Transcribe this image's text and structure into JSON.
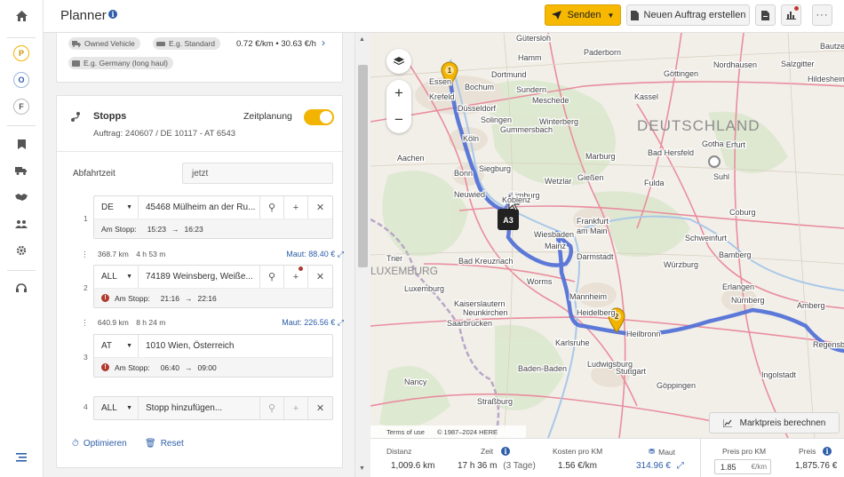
{
  "rail": {
    "icons": [
      "home-icon",
      "bookmark-icon",
      "truck-icon",
      "handshake-icon",
      "users-icon",
      "gear-icon",
      "headset-icon",
      "sidebar-toggle-icon"
    ],
    "circles": [
      {
        "letter": "P",
        "color": "#f2b400"
      },
      {
        "letter": "O",
        "color": "#2d5ea8"
      },
      {
        "letter": "F",
        "color": "#555555"
      }
    ]
  },
  "header": {
    "title": "Planner",
    "send_label": "Senden",
    "new_order_label": "Neuen Auftrag erstellen"
  },
  "vehicle": {
    "vehicle_chip": "Owned Vehicle",
    "standard_chip": "E.g. Standard",
    "price_text": "0.72 €/km • 30.63 €/h",
    "region_chip": "E.g. Germany (long haul)"
  },
  "stops": {
    "title": "Stopps",
    "order_text": "Auftrag: 240607 / DE 10117 - AT 6543",
    "schedule_label": "Zeitplanung",
    "departure_label": "Abfahrtzeit",
    "departure_value": "jetzt",
    "items": [
      {
        "num": "1",
        "country": "DE",
        "address": "45468 Mülheim an der Ru...",
        "stop_label": "Am Stopp:",
        "arrive": "15:23",
        "depart": "16:23"
      },
      {
        "num": "2",
        "country": "ALL",
        "address": "74189 Weinsberg, Weiße...",
        "stop_label": "Am Stopp:",
        "arrive": "21:16",
        "depart": "22:16"
      },
      {
        "num": "3",
        "country": "AT",
        "address": "1010 Wien, Österreich",
        "stop_label": "Am Stopp:",
        "arrive": "06:40",
        "depart": "09:00"
      },
      {
        "num": "4",
        "country": "ALL",
        "placeholder": "Stopp hinzufügen..."
      }
    ],
    "legs": [
      {
        "km": "368.7 km",
        "time": "4 h 53 m",
        "maut": "Maut: 88.40 €"
      },
      {
        "km": "640.9 km",
        "time": "8 h 24 m",
        "maut": "Maut: 226.56 €"
      }
    ],
    "optimize_label": "Optimieren",
    "reset_label": "Reset"
  },
  "map": {
    "terms": "Terms of use",
    "copyright": "© 1987–2024 HERE",
    "market_button": "Marktpreis berechnen",
    "labels": {
      "country_de": "DEUTSCHLAND",
      "country_lux": "LUXEMBURG",
      "highway": "A3",
      "cities": [
        "Gütersloh",
        "Hamm",
        "Paderborn",
        "Dortmund",
        "Bochum",
        "Essen",
        "Krefeld",
        "Düsseldorf",
        "Solingen",
        "Köln",
        "Bonn",
        "Siegburg",
        "Aachen",
        "Meschede",
        "Winterberg",
        "Kassel",
        "Göttingen",
        "Nordhausen",
        "Gotha",
        "Erfurt",
        "Marburg",
        "Gießen",
        "Fulda",
        "Suhl",
        "Coburg",
        "Bad Hersfeld",
        "Limburg",
        "Koblenz",
        "Wiesbaden",
        "Mainz",
        "Frankfurt am Main",
        "Darmstadt",
        "Bad Kreuznach",
        "Worms",
        "Mannheim",
        "Heidelberg",
        "Kaiserslautern",
        "Neunkirchen",
        "Saarbrücken",
        "Luxemburg",
        "Trier",
        "Karlsruhe",
        "Heilbronn",
        "Stuttgart",
        "Ludwigsburg",
        "Baden-Baden",
        "Würzburg",
        "Schweinfurt",
        "Bamberg",
        "Erlangen",
        "Nürnberg",
        "Ingolstadt",
        "Regensburg",
        "Göppingen",
        "Nancy",
        "Straßburg",
        "Amberg",
        "Wetzlar",
        "Neuwied",
        "Gummersbach",
        "Sundern",
        "Bautzen",
        "Salzgitter",
        "Hildesheim"
      ]
    },
    "markers": [
      "1",
      "2"
    ]
  },
  "stats": {
    "distance_label": "Distanz",
    "distance_value": "1,009.6 km",
    "time_label": "Zeit",
    "time_value": "17 h 36 m",
    "time_days": "(3 Tage)",
    "cost_label": "Kosten pro KM",
    "cost_value": "1.56 €/km",
    "maut_label": "Maut",
    "maut_value": "314.96 €",
    "price_km_label": "Preis pro KM",
    "price_km_value": "1.85",
    "price_km_unit": "€/km",
    "price_label": "Preis",
    "price_value": "1,875.76 €"
  }
}
